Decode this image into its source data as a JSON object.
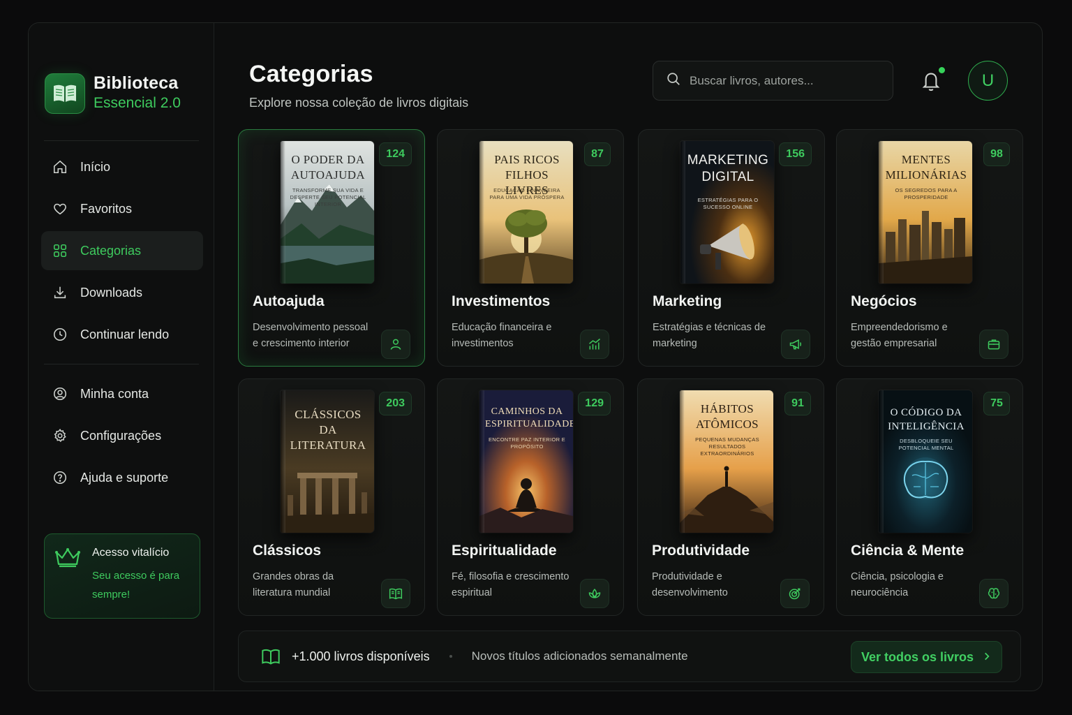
{
  "window": {
    "brand": {
      "title": "Biblioteca",
      "subtitle": "Essencial 2.0",
      "logo_icon": "open-book-icon"
    },
    "sidebar": {
      "items": [
        {
          "label": "Início",
          "icon": "home-icon"
        },
        {
          "label": "Favoritos",
          "icon": "heart-icon"
        },
        {
          "label": "Categorias",
          "icon": "grid-icon",
          "active": true
        },
        {
          "label": "Downloads",
          "icon": "download-icon"
        },
        {
          "label": "Continuar lendo",
          "icon": "clock-icon"
        }
      ],
      "secondary": [
        {
          "label": "Minha conta",
          "icon": "user-circle-icon"
        },
        {
          "label": "Configurações",
          "icon": "gear-icon"
        },
        {
          "label": "Ajuda e suporte",
          "icon": "help-icon"
        }
      ],
      "access": {
        "title": "Acesso vitalício",
        "subtitle": "Seu acesso é para sempre!",
        "icon": "crown-icon"
      }
    },
    "header": {
      "title": "Categorias",
      "subtitle": "Explore nossa coleção de livros digitais",
      "search_placeholder": "Buscar livros, autores...",
      "avatar_initial": "U"
    },
    "categories": [
      {
        "name": "Autoajuda",
        "description": "Desenvolvimento pessoal e crescimento interior",
        "count": "124",
        "icon": "person-icon",
        "book": {
          "title": "O PODER DA AUTOAJUDA",
          "subtitle": "TRANSFORME SUA VIDA E DESPERTE SEU POTENCIAL INTERIOR"
        }
      },
      {
        "name": "Investimentos",
        "description": "Educação financeira e investimentos",
        "count": "87",
        "icon": "chart-bars-icon",
        "book": {
          "title": "PAIS RICOS FILHOS LIVRES",
          "subtitle": "EDUCAÇÃO FINANCEIRA PARA UMA VIDA PRÓSPERA"
        }
      },
      {
        "name": "Marketing",
        "description": "Estratégias e técnicas de marketing",
        "count": "156",
        "icon": "megaphone-icon",
        "book": {
          "title": "MARKETING DIGITAL",
          "subtitle": "ESTRATÉGIAS PARA O SUCESSO ONLINE"
        }
      },
      {
        "name": "Negócios",
        "description": "Empreendedorismo e gestão empresarial",
        "count": "98",
        "icon": "briefcase-icon",
        "book": {
          "title": "MENTES MILIONÁRIAS",
          "subtitle": "OS SEGREDOS PARA A PROSPERIDADE"
        }
      },
      {
        "name": "Clássicos",
        "description": "Grandes obras da literatura mundial",
        "count": "203",
        "icon": "book-icon",
        "book": {
          "title": "CLÁSSICOS DA LITERATURA",
          "subtitle": ""
        }
      },
      {
        "name": "Espiritualidade",
        "description": "Fé, filosofia e crescimento espiritual",
        "count": "129",
        "icon": "lotus-icon",
        "book": {
          "title": "CAMINHOS DA ESPIRITUALIDADE",
          "subtitle": "ENCONTRE PAZ INTERIOR E PROPÓSITO"
        }
      },
      {
        "name": "Produtividade",
        "description": "Produtividade e desenvolvimento",
        "count": "91",
        "icon": "target-icon",
        "book": {
          "title": "HÁBITOS ATÔMICOS",
          "subtitle": "PEQUENAS MUDANÇAS RESULTADOS EXTRAORDINÁRIOS"
        }
      },
      {
        "name": "Ciência & Mente",
        "description": "Ciência, psicologia e neurociência",
        "count": "75",
        "icon": "brain-icon",
        "book": {
          "title": "O CÓDIGO DA INTELIGÊNCIA",
          "subtitle": "DESBLOQUEIE SEU POTENCIAL MENTAL"
        }
      }
    ],
    "footer": {
      "count_text": "+1.000 livros disponíveis",
      "note": "Novos títulos adicionados semanalmente",
      "button_label": "Ver todos os livros"
    },
    "colors": {
      "accent": "#3ecb5e",
      "background": "#0d0e0e",
      "card": "#141615"
    }
  }
}
